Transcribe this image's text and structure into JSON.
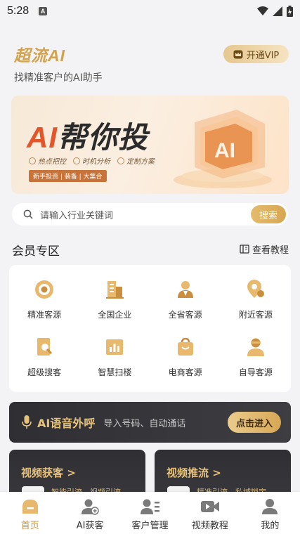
{
  "status_bar": {
    "time": "5:28",
    "notification_letter": "A"
  },
  "header": {
    "brand": "超流AI",
    "tagline": "找精准客户的AI助手",
    "vip_label": "开通VIP"
  },
  "banner": {
    "title_ai": "AI",
    "title_rest": "帮你投",
    "features": [
      "热点把控",
      "时机分析",
      "定制方案"
    ],
    "tag": "新手投资 | 装备 | 大集合",
    "art_text": "AI"
  },
  "search": {
    "placeholder": "请输入行业关键词",
    "button": "搜索"
  },
  "member_section": {
    "title": "会员专区",
    "tutorial_link": "查看教程",
    "items": [
      {
        "label": "精准客源",
        "icon": "target-icon"
      },
      {
        "label": "全国企业",
        "icon": "building-icon"
      },
      {
        "label": "全省客源",
        "icon": "people-icon"
      },
      {
        "label": "附近客源",
        "icon": "location-icon"
      },
      {
        "label": "超级搜客",
        "icon": "search-doc-icon"
      },
      {
        "label": "智慧扫楼",
        "icon": "chart-icon"
      },
      {
        "label": "电商客源",
        "icon": "shopping-bag-icon"
      },
      {
        "label": "自导客源",
        "icon": "person-icon"
      }
    ]
  },
  "ai_call": {
    "title": "AI语音外呼",
    "subtitle": "导入号码、自动通话",
    "button": "点击进入"
  },
  "video_cards": [
    {
      "title": "视频获客 >",
      "subtitle": "智能引流，视频引流"
    },
    {
      "title": "视频推流 >",
      "subtitle": "精准引流，私域锁定"
    }
  ],
  "tab_bar": {
    "items": [
      {
        "label": "首页",
        "icon": "home-icon"
      },
      {
        "label": "AI获客",
        "icon": "add-user-icon"
      },
      {
        "label": "客户管理",
        "icon": "contacts-icon"
      },
      {
        "label": "视频教程",
        "icon": "video-icon"
      },
      {
        "label": "我的",
        "icon": "profile-icon"
      }
    ],
    "active_index": 0
  },
  "colors": {
    "accent": "#d2a24d",
    "dark": "#2f2f33",
    "active_tab": "#c9933e"
  }
}
